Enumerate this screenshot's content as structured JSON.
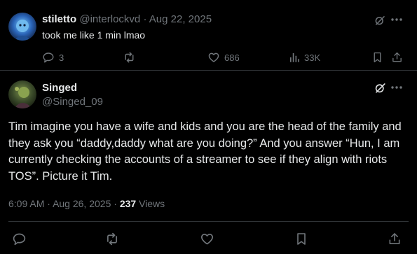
{
  "reply": {
    "display_name": "stiletto",
    "handle": "@interlockvd",
    "separator": "·",
    "date": "Aug 22, 2025",
    "text": "took me like 1 min lmao",
    "stats": {
      "replies": "3",
      "likes": "686",
      "views": "33K"
    }
  },
  "main": {
    "display_name": "Singed",
    "handle": "@Singed_09",
    "text": "Tim imagine you have a wife and kids and you are the head of the family and they ask you “daddy,daddy what are you doing?” And you answer “Hun, I am currently checking the accounts of a streamer to see if they align with riots TOS”. Picture it Tim.",
    "time": "6:09 AM",
    "separator1": "·",
    "date": "Aug 26, 2025",
    "separator2": "·",
    "views_count": "237",
    "views_label": "Views"
  },
  "colors": {
    "background": "#000000",
    "text": "#e7e9ea",
    "muted": "#71767b",
    "divider": "#2f3336"
  },
  "icons": [
    "grok-icon",
    "more-icon",
    "reply-icon",
    "retweet-icon",
    "like-icon",
    "views-icon",
    "bookmark-icon",
    "share-icon"
  ]
}
